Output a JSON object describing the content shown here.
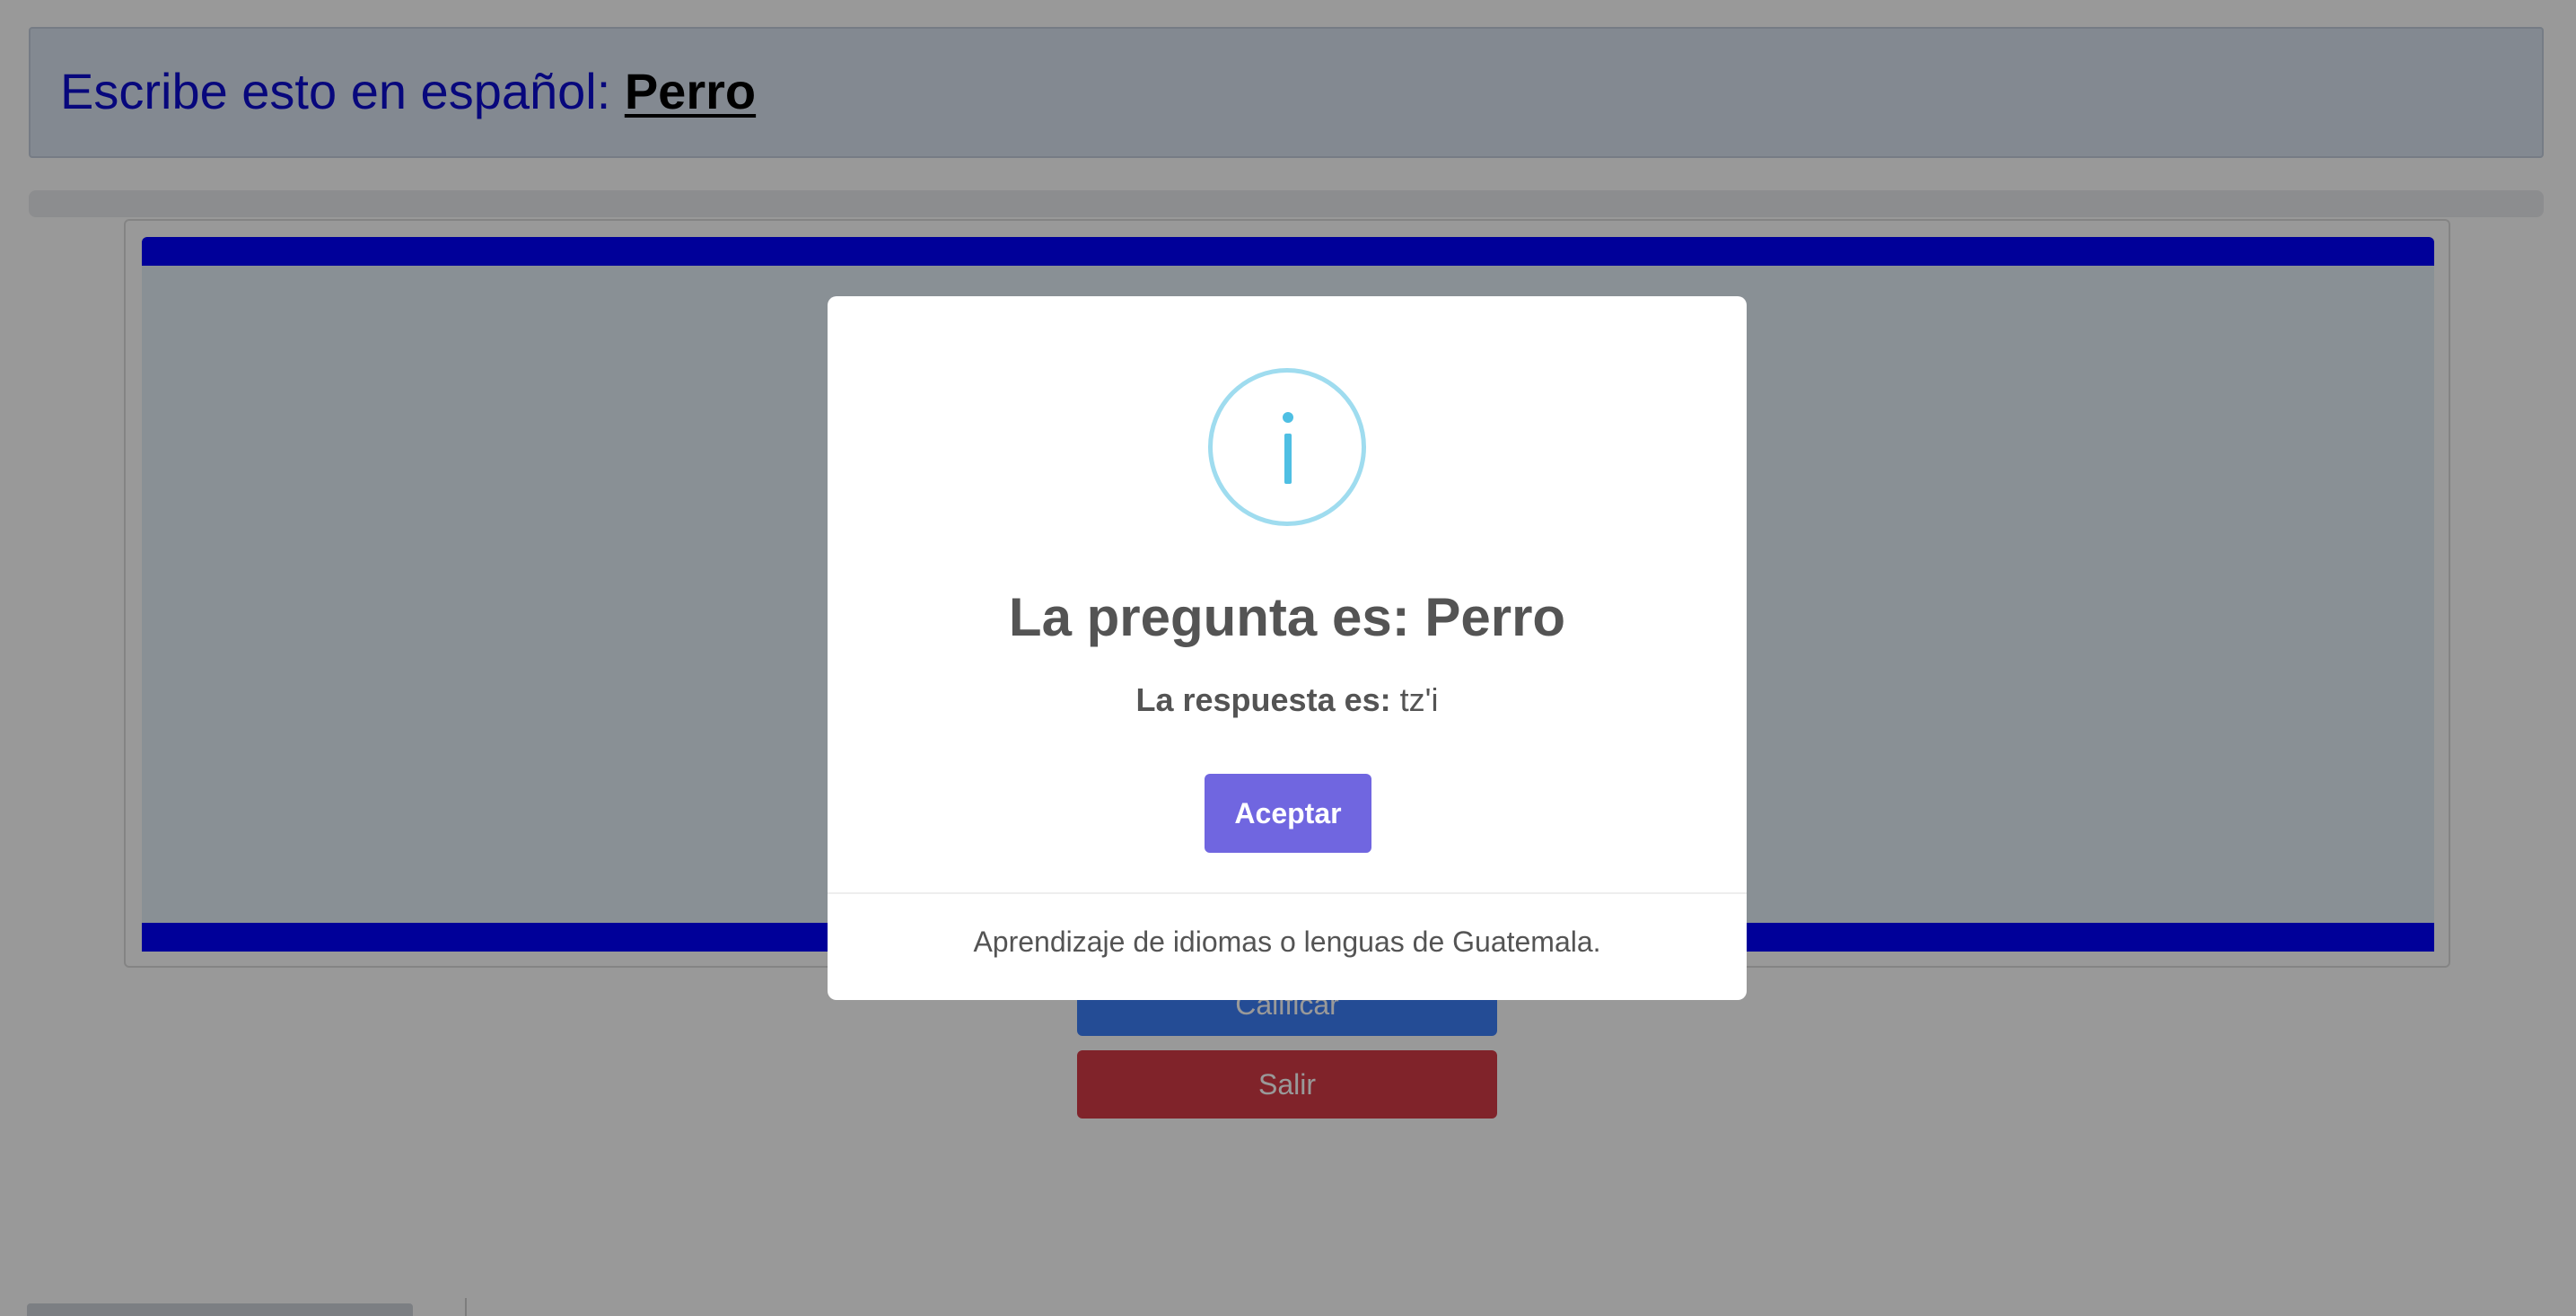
{
  "header": {
    "prompt": "Escribe esto en español: ",
    "word": "Perro"
  },
  "buttons": {
    "grade_label": "Calificar",
    "exit_label": "Salir"
  },
  "modal": {
    "icon": "info-icon",
    "title": "La pregunta es: Perro",
    "answer_label": "La respuesta es:",
    "answer_value": " tz'i",
    "accept_label": "Aceptar",
    "footer": "Aprendizaje de idiomas o lenguas de Guatemala."
  },
  "colors": {
    "header_text": "#0c0ccf",
    "band_blue": "#0000ff",
    "primary_button": "#3d7ff9",
    "danger_button": "#d63b46",
    "accept_button": "#7066e0",
    "info_icon": "#9fdcef"
  }
}
